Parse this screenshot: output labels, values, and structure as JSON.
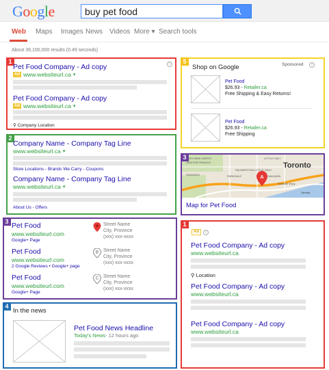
{
  "header": {
    "logo": [
      "G",
      "o",
      "o",
      "g",
      "l",
      "e"
    ],
    "logo_colors": [
      "#4285f4",
      "#ea4335",
      "#fbbc05",
      "#4285f4",
      "#34a853",
      "#ea4335"
    ],
    "search_value": "buy pet food",
    "search_icon": "search-icon"
  },
  "nav": {
    "items": [
      "Web",
      "Maps",
      "Images",
      "News",
      "Videos",
      "More ▾",
      "Search tools"
    ]
  },
  "results_count": "About 39,100,000 results (0.49 seconds)",
  "box1": {
    "num": "1",
    "ads": [
      {
        "title": "Pet Food Company - Ad copy",
        "badge": "Ad",
        "url": "www.websiteurl.ca"
      },
      {
        "title": "Pet Food Company - Ad copy",
        "badge": "Ad",
        "url": "www.websiteurl.ca"
      }
    ],
    "location": "Company Location"
  },
  "box2": {
    "num": "2",
    "results": [
      {
        "title": "Company Name - Company Tag Line",
        "url": "www.websiteurl.ca",
        "links": "Store Locations - Brands We Carry - Coupons"
      },
      {
        "title": "Company Name - Company Tag Line",
        "url": "www.websiteurl.ca",
        "links": "About Us - Offers"
      }
    ]
  },
  "box3": {
    "num": "3",
    "listings": [
      {
        "title": "Pet Food",
        "url": "www.websiteurl.com",
        "sub": "Google+ Page",
        "pin": "A",
        "street": "Street Name",
        "city": "City, Province",
        "phone": "(xxx) xxx-xxxx"
      },
      {
        "title": "Pet Food",
        "url": "www.websiteurl.com",
        "sub": "2 Google Reviews • Google+ page",
        "pin": "B",
        "street": "Street Name",
        "city": "City, Province",
        "phone": "(xxx) xxx-xxxx"
      },
      {
        "title": "Pet Food",
        "url": "www.websiteurl.com",
        "sub": "Google+ Page",
        "pin": "C",
        "street": "Street Name",
        "city": "City, Province",
        "phone": "(xxx) xxx-xxxx"
      }
    ]
  },
  "box4": {
    "num": "4",
    "heading": "In the news",
    "headline": "Pet Food News Headline",
    "source": "Today's News",
    "time": " - 12 hours ago"
  },
  "box5": {
    "num": "5",
    "title": "Shop on Google",
    "sponsored": "Sponsored",
    "products": [
      {
        "name": "Pet Food",
        "price": "$26.93",
        "retailer": "Retailer.ca",
        "shipping": "Free Shipping & Easy Returns!"
      },
      {
        "name": "Pet Food",
        "price": "$26.93",
        "retailer": "Retailer.ca",
        "shipping": "Free Shipping"
      }
    ]
  },
  "map": {
    "num": "3",
    "caption": "Map for Pet Food",
    "marker": "A",
    "labels": [
      "HIGH PARK NORTH",
      "LITTLE ITALY",
      "Toronto",
      "JUNCTION TRIANGLE",
      "PALMERSTON-LITTLE ITALY",
      "SWANSEA",
      "PARKDALE",
      "NIAGARA",
      "Gardiner Expy",
      "Toronto"
    ]
  },
  "box1b": {
    "num": "1",
    "badge": "Ad",
    "ads": [
      {
        "title": "Pet Food Company - Ad copy",
        "url": "www.websiteurl.ca"
      },
      {
        "title": "Pet Food Company - Ad copy",
        "url": "www.websiteurl.ca"
      },
      {
        "title": "Pet Food Company - Ad copy",
        "url": "www.websiteurl.ca"
      }
    ],
    "location": "Location"
  },
  "colors": {
    "red": "#e53935",
    "green": "#43a047",
    "purple": "#6a3d9a",
    "blue": "#1e6ab1",
    "yellow": "#f5d327",
    "link": "#1a0dab",
    "url": "#2c9e3c"
  }
}
